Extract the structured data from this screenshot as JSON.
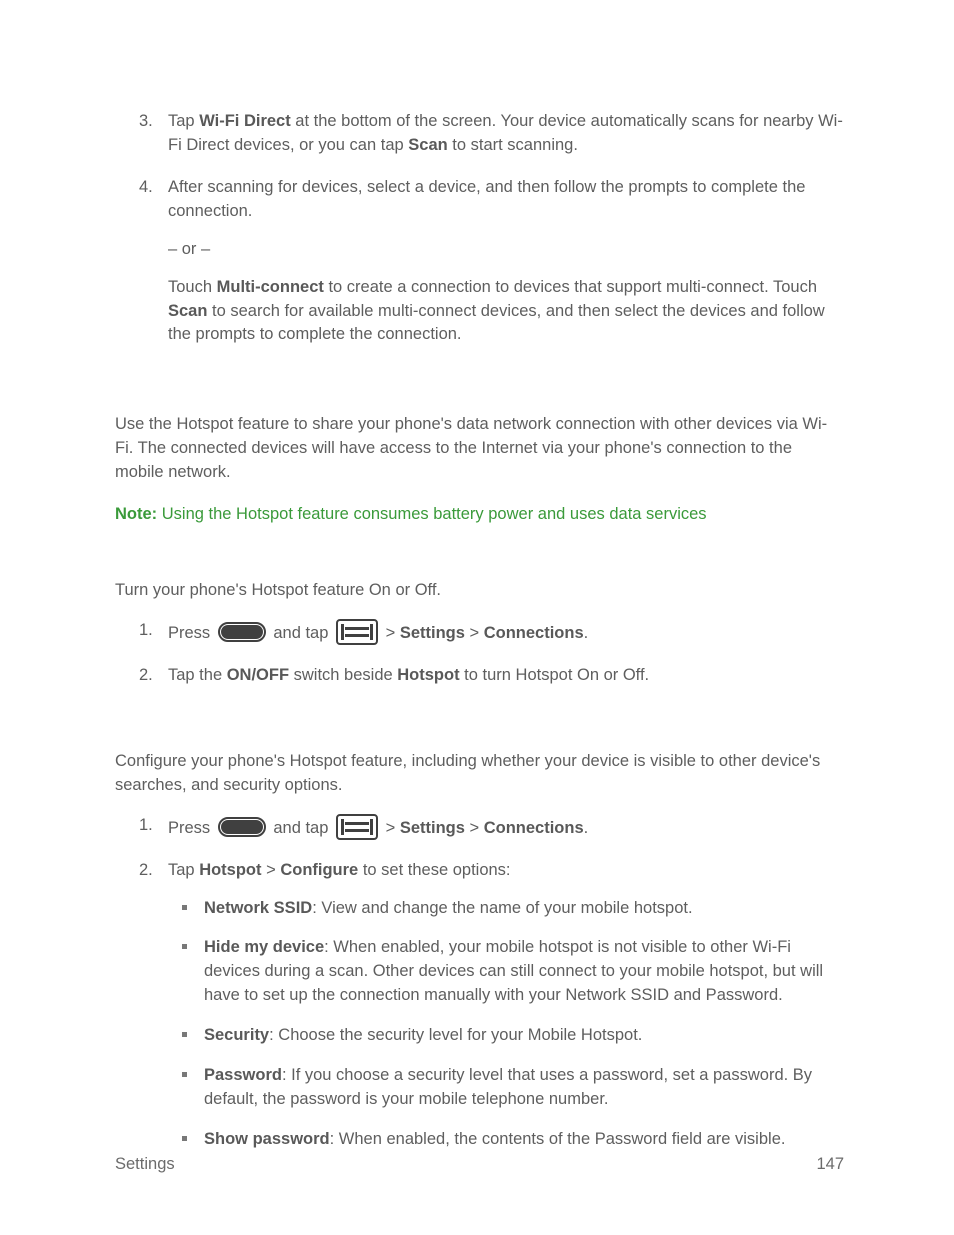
{
  "steps_a": [
    {
      "num": "3.",
      "pre": "Tap ",
      "b1": "Wi-Fi Direct",
      "mid1": " at the bottom of the screen. Your device automatically scans for nearby Wi-Fi Direct devices, or you can tap ",
      "b2": "Scan",
      "mid2": " to start scanning."
    },
    {
      "num": "4.",
      "line1": "After scanning for devices, select a device, and then follow the prompts to complete the connection.",
      "or": "– or –",
      "line2_pre": "Touch ",
      "line2_b1": "Multi-connect",
      "line2_mid": " to create a connection to devices that support multi-connect. Touch ",
      "line2_b2": "Scan",
      "line2_end": " to search for available multi-connect devices, and then select the devices and follow the prompts to complete the connection."
    }
  ],
  "hotspot_intro": "Use the Hotspot feature to share your phone's data network connection with other devices via Wi-Fi. The connected devices will have access to the Internet via your phone's connection to the mobile network.",
  "note_label": "Note:",
  "note_text": " Using the Hotspot feature consumes battery power and uses data services",
  "turn_intro": "Turn your phone's Hotspot feature On or Off.",
  "press_line": {
    "num1": "1.",
    "press": "Press ",
    "and_tap": " and tap ",
    "gt": " > ",
    "settings": "Settings",
    "connections": "Connections",
    "period": "."
  },
  "turn_step2": {
    "num": "2.",
    "pre": "Tap the ",
    "b1": "ON/OFF",
    "mid": " switch beside ",
    "b2": "Hotspot",
    "end": " to turn Hotspot On or Off."
  },
  "config_intro": "Configure your phone's Hotspot feature, including whether your device is visible to other device's searches, and security options.",
  "config_step2": {
    "num": "2.",
    "pre": "Tap ",
    "b1": "Hotspot",
    "mid": " > ",
    "b2": "Configure",
    "end": " to set these options:"
  },
  "options": [
    {
      "b": "Network SSID",
      "t": ": View and change the name of your mobile hotspot."
    },
    {
      "b": "Hide my device",
      "t": ": When enabled, your mobile hotspot is not visible to other Wi-Fi devices during a scan. Other devices can still connect to your mobile hotspot, but will have to set up the connection manually with your Network SSID and Password."
    },
    {
      "b": "Security",
      "t": ": Choose the security level for your Mobile Hotspot."
    },
    {
      "b": "Password",
      "t": ": If you choose a security level that uses a password, set a password. By default, the password is your mobile telephone number."
    },
    {
      "b": "Show password",
      "t": ": When enabled, the contents of the Password field are visible."
    }
  ],
  "footer": {
    "left": "Settings",
    "right": "147"
  }
}
